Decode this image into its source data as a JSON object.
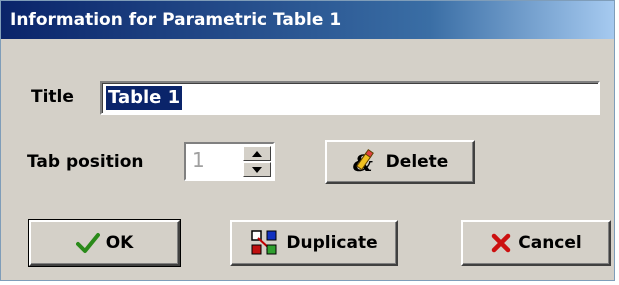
{
  "window": {
    "title": "Information for Parametric Table 1"
  },
  "form": {
    "title_label": "Title",
    "title_value": "Table 1",
    "tab_position_label": "Tab position",
    "tab_position_value": "1"
  },
  "buttons": {
    "delete_label": "Delete",
    "ok_label": "OK",
    "duplicate_label": "Duplicate",
    "cancel_label": "Cancel"
  },
  "icons": {
    "delete": "eraser-icon",
    "ok": "checkmark-icon",
    "duplicate": "duplicate-icon",
    "cancel": "x-icon",
    "spin_up": "spin-up-arrow-icon",
    "spin_down": "spin-down-arrow-icon"
  },
  "colors": {
    "titlebar_start": "#0a246a",
    "titlebar_end": "#a6caf0",
    "dialog_face": "#d4d0c8",
    "selection": "#0a246a",
    "ok_check": "#2a8a1a",
    "cancel_x": "#cc1010"
  }
}
